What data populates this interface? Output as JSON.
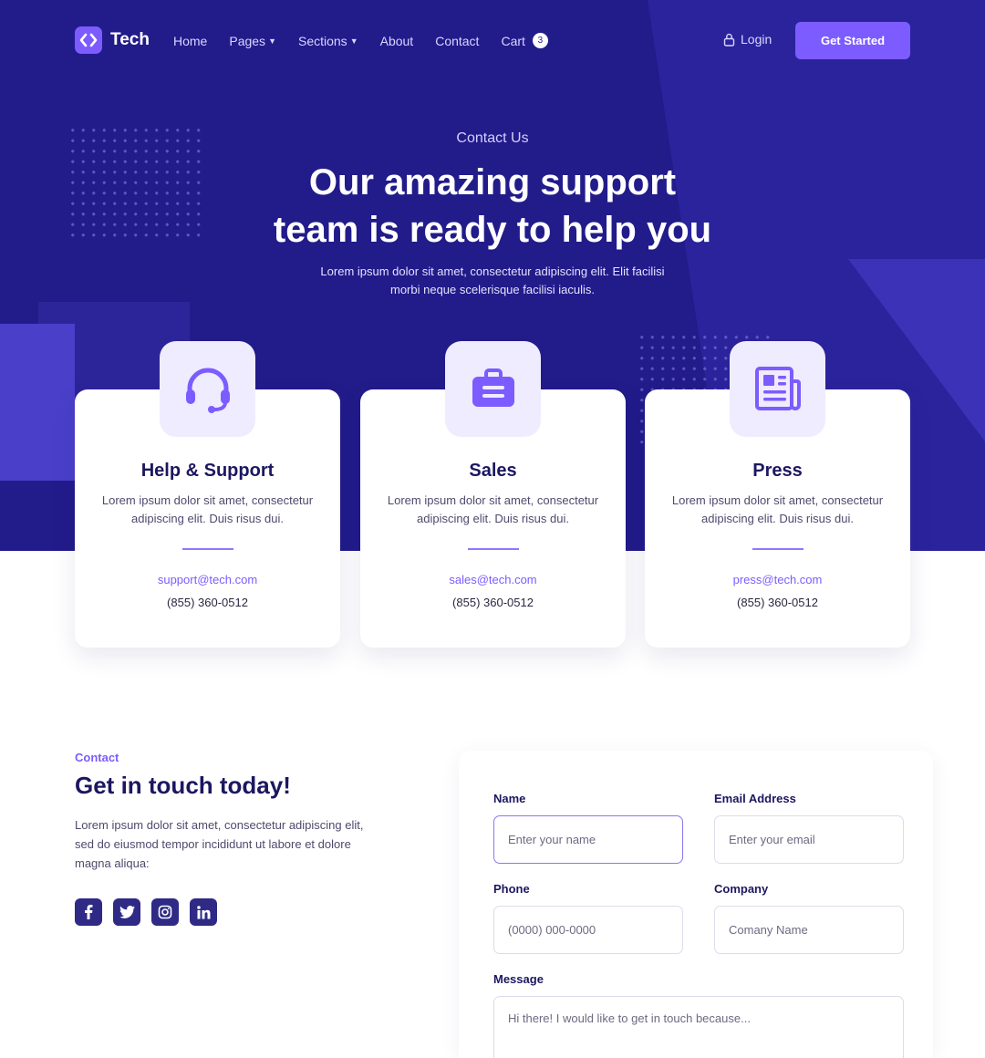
{
  "nav": {
    "brand": "Tech",
    "items": [
      {
        "label": "Home",
        "caret": false
      },
      {
        "label": "Pages",
        "caret": true
      },
      {
        "label": "Sections",
        "caret": true
      },
      {
        "label": "About",
        "caret": false
      },
      {
        "label": "Contact",
        "caret": false
      },
      {
        "label": "Cart",
        "caret": false
      }
    ],
    "cart_count": "3",
    "login": "Login",
    "cta": "Get Started"
  },
  "hero": {
    "eyebrow": "Contact Us",
    "title_line1": "Our amazing support",
    "title_line2": "team is ready to help you",
    "subtext": "Lorem ipsum dolor sit amet, consectetur adipiscing elit. Elit facilisi morbi neque scelerisque facilisi iaculis."
  },
  "cards": [
    {
      "icon": "headset-icon",
      "title": "Help & Support",
      "desc": "Lorem ipsum dolor sit amet, consectetur adipiscing elit. Duis risus dui.",
      "email": "support@tech.com",
      "phone": "(855) 360-0512"
    },
    {
      "icon": "briefcase-icon",
      "title": "Sales",
      "desc": "Lorem ipsum dolor sit amet, consectetur adipiscing elit. Duis risus dui.",
      "email": "sales@tech.com",
      "phone": "(855) 360-0512"
    },
    {
      "icon": "newspaper-icon",
      "title": "Press",
      "desc": "Lorem ipsum dolor sit amet, consectetur adipiscing elit. Duis risus dui.",
      "email": "press@tech.com",
      "phone": "(855) 360-0512"
    }
  ],
  "contact": {
    "eyebrow": "Contact",
    "title": "Get in touch today!",
    "desc": "Lorem ipsum dolor sit amet, consectetur adipiscing elit, sed do eiusmod tempor incididunt ut labore et dolore magna aliqua:",
    "socials": [
      "facebook-icon",
      "twitter-icon",
      "instagram-icon",
      "linkedin-icon"
    ]
  },
  "form": {
    "name_label": "Name",
    "name_placeholder": "Enter your name",
    "email_label": "Email Address",
    "email_placeholder": "Enter your email",
    "phone_label": "Phone",
    "phone_placeholder": "(0000) 000-0000",
    "company_label": "Company",
    "company_placeholder": "Comany Name",
    "message_label": "Message",
    "message_placeholder": "Hi there! I would like to get in touch because..."
  },
  "colors": {
    "hero_bg": "#221b8a",
    "accent": "#7c5cff",
    "heading": "#1c1760",
    "icon_tile": "#efecff",
    "social_bg": "#2e2a85"
  }
}
